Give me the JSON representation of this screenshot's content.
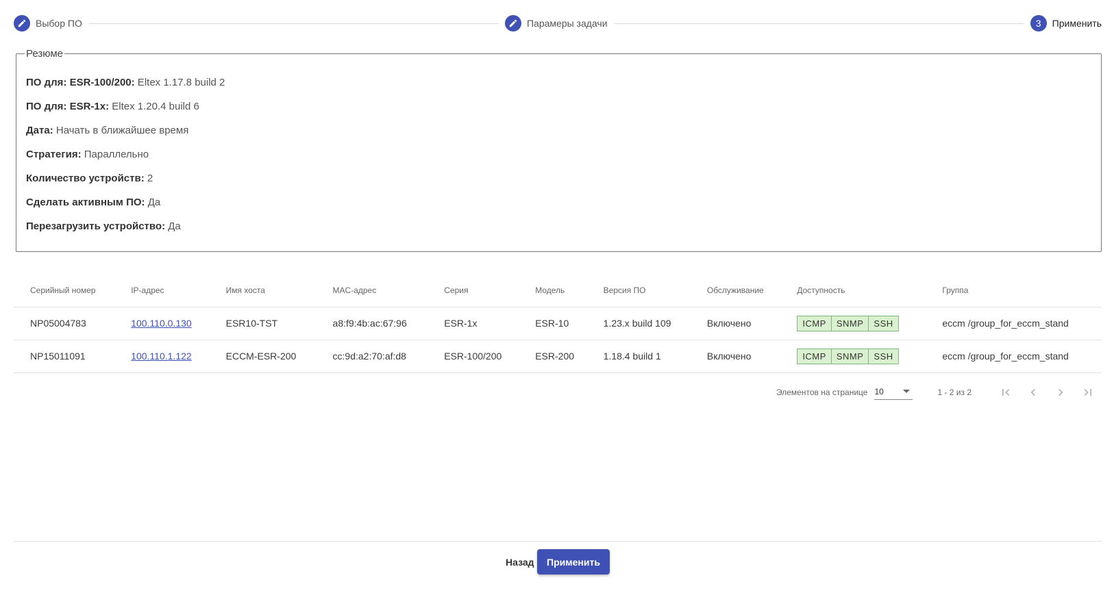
{
  "stepper": {
    "steps": [
      {
        "label": "Выбор ПО",
        "icon": "pencil-icon"
      },
      {
        "label": "Парамеры задачи",
        "icon": "pencil-icon"
      },
      {
        "label": "Применить",
        "number": "3"
      }
    ]
  },
  "summary": {
    "legend": "Резюме",
    "rows": [
      {
        "label": "ПО для: ESR-100/200:",
        "value": " Eltex 1.17.8 build 2"
      },
      {
        "label": "ПО для: ESR-1x:",
        "value": " Eltex 1.20.4 build 6"
      },
      {
        "label": "Дата:",
        "value": " Начать в ближайшее время"
      },
      {
        "label": "Стратегия:",
        "value": " Параллельно"
      },
      {
        "label": "Количество устройств:",
        "value": " 2"
      },
      {
        "label": "Сделать активным ПО:",
        "value": " Да"
      },
      {
        "label": "Перезагрузить устройство:",
        "value": " Да"
      }
    ]
  },
  "table": {
    "columns": [
      "Серийный номер",
      "IP-адрес",
      "Имя хоста",
      "MAC-адрес",
      "Серия",
      "Модель",
      "Версия ПО",
      "Обслуживание",
      "Доступность",
      "Группа"
    ],
    "rows": [
      {
        "serial": "NP05004783",
        "ip": "100.110.0.130",
        "host": "ESR10-TST",
        "mac": "a8:f9:4b:ac:67:96",
        "series": "ESR-1x",
        "model": "ESR-10",
        "version": "1.23.x build 109",
        "service": "Включено",
        "avail": [
          "ICMP",
          "SNMP",
          "SSH"
        ],
        "group": "eccm /group_for_eccm_stand"
      },
      {
        "serial": "NP15011091",
        "ip": "100.110.1.122",
        "host": "ECCM-ESR-200",
        "mac": "cc:9d:a2:70:af:d8",
        "series": "ESR-100/200",
        "model": "ESR-200",
        "version": "1.18.4 build 1",
        "service": "Включено",
        "avail": [
          "ICMP",
          "SNMP",
          "SSH"
        ],
        "group": "eccm /group_for_eccm_stand"
      }
    ]
  },
  "paginator": {
    "items_per_page_label": "Элементов на странице",
    "page_size": "10",
    "range": "1 - 2 из 2"
  },
  "footer": {
    "back_label": "Назад",
    "apply_label": "Применить"
  },
  "colors": {
    "accent": "#3f51b5",
    "availability_bg": "#d9f1cf",
    "availability_border": "#7cb87c"
  }
}
